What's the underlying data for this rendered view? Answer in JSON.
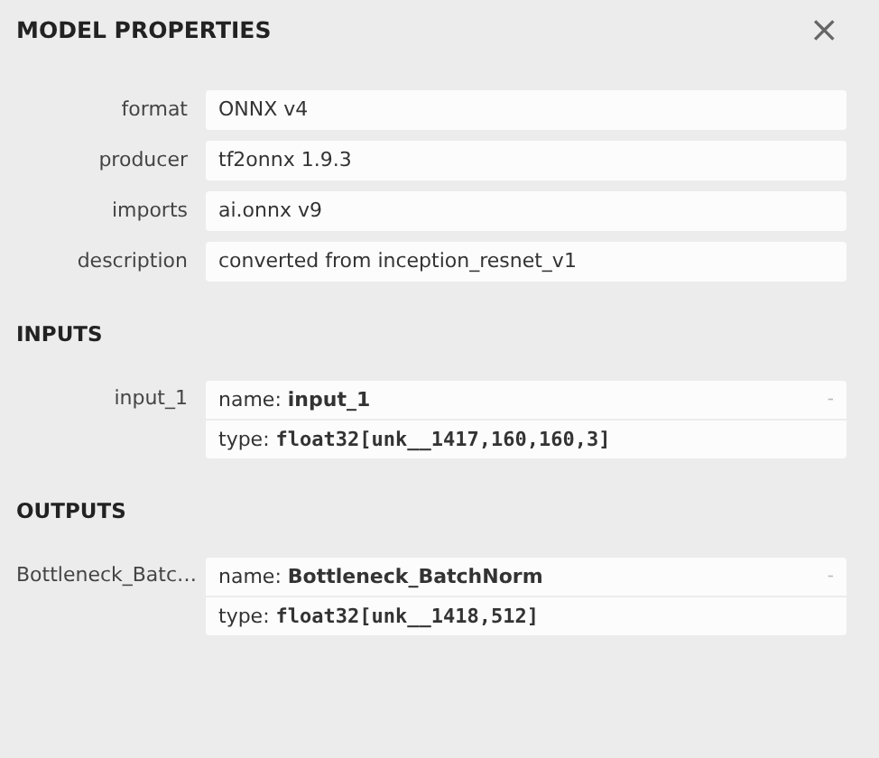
{
  "title": "MODEL PROPERTIES",
  "close": "×",
  "properties": [
    {
      "label": "format",
      "value": "ONNX v4"
    },
    {
      "label": "producer",
      "value": "tf2onnx 1.9.3"
    },
    {
      "label": "imports",
      "value": "ai.onnx v9"
    },
    {
      "label": "description",
      "value": "converted from inception_resnet_v1"
    }
  ],
  "sections": [
    {
      "heading": "INPUTS",
      "items": [
        {
          "label": "input_1",
          "name_label": "name:",
          "name": "input_1",
          "expander": "-",
          "type_label": "type:",
          "type": "float32[unk__1417,160,160,3]"
        }
      ]
    },
    {
      "heading": "OUTPUTS",
      "items": [
        {
          "label": "Bottleneck_Batc…",
          "name_label": "name:",
          "name": "Bottleneck_BatchNorm",
          "expander": "-",
          "type_label": "type:",
          "type": "float32[unk__1418,512]"
        }
      ]
    }
  ]
}
